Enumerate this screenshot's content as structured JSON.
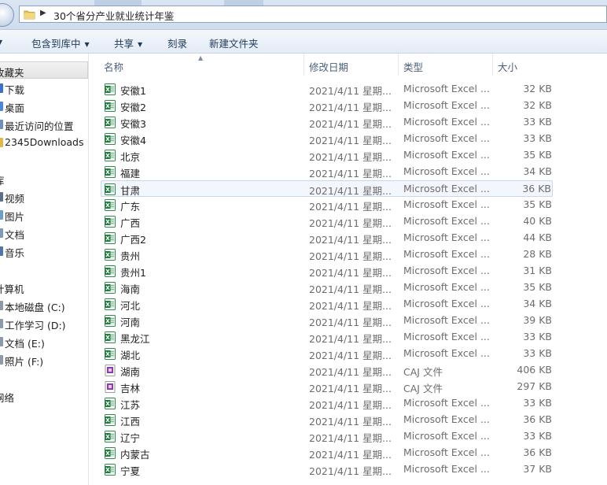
{
  "address": {
    "path": "30个省分产业就业统计年鉴"
  },
  "toolbar": {
    "items": [
      {
        "label": "包含到库中",
        "dropdown": true
      },
      {
        "label": "共享",
        "dropdown": true
      },
      {
        "label": "刻录",
        "dropdown": false
      },
      {
        "label": "新建文件夹",
        "dropdown": false
      }
    ]
  },
  "nav": {
    "items": [
      {
        "label": "收藏夹",
        "kind": "group",
        "selected": true
      },
      {
        "label": "下载",
        "kind": "item"
      },
      {
        "label": "桌面",
        "kind": "item"
      },
      {
        "label": "最近访问的位置",
        "kind": "item"
      },
      {
        "label": "2345Downloads",
        "kind": "item"
      },
      {
        "label": "库",
        "kind": "group"
      },
      {
        "label": "视频",
        "kind": "item"
      },
      {
        "label": "图片",
        "kind": "item"
      },
      {
        "label": "文档",
        "kind": "item"
      },
      {
        "label": "音乐",
        "kind": "item"
      },
      {
        "label": "计算机",
        "kind": "group"
      },
      {
        "label": "本地磁盘 (C:)",
        "kind": "item"
      },
      {
        "label": "工作学习 (D:)",
        "kind": "item"
      },
      {
        "label": "文档 (E:)",
        "kind": "item"
      },
      {
        "label": "照片 (F:)",
        "kind": "item"
      },
      {
        "label": "网络",
        "kind": "group"
      }
    ]
  },
  "columns": {
    "name": "名称",
    "date": "修改日期",
    "type": "类型",
    "size": "大小"
  },
  "files": [
    {
      "name": "安徽1",
      "date": "2021/4/11 星期...",
      "type": "Microsoft Excel ...",
      "size": "32 KB",
      "icon": "excel-file-icon"
    },
    {
      "name": "安徽2",
      "date": "2021/4/11 星期...",
      "type": "Microsoft Excel ...",
      "size": "32 KB",
      "icon": "excel-file-icon"
    },
    {
      "name": "安徽3",
      "date": "2021/4/11 星期...",
      "type": "Microsoft Excel ...",
      "size": "33 KB",
      "icon": "excel-file-icon"
    },
    {
      "name": "安徽4",
      "date": "2021/4/11 星期...",
      "type": "Microsoft Excel ...",
      "size": "33 KB",
      "icon": "excel-file-icon"
    },
    {
      "name": "北京",
      "date": "2021/4/11 星期...",
      "type": "Microsoft Excel ...",
      "size": "35 KB",
      "icon": "excel-file-icon"
    },
    {
      "name": "福建",
      "date": "2021/4/11 星期...",
      "type": "Microsoft Excel ...",
      "size": "34 KB",
      "icon": "excel-file-icon"
    },
    {
      "name": "甘肃",
      "date": "2021/4/11 星期...",
      "type": "Microsoft Excel ...",
      "size": "36 KB",
      "icon": "excel-file-icon",
      "hover": true
    },
    {
      "name": "广东",
      "date": "2021/4/11 星期...",
      "type": "Microsoft Excel ...",
      "size": "35 KB",
      "icon": "excel-file-icon"
    },
    {
      "name": "广西",
      "date": "2021/4/11 星期...",
      "type": "Microsoft Excel ...",
      "size": "40 KB",
      "icon": "excel-file-icon"
    },
    {
      "name": "广西2",
      "date": "2021/4/11 星期...",
      "type": "Microsoft Excel ...",
      "size": "44 KB",
      "icon": "excel-file-icon"
    },
    {
      "name": "贵州",
      "date": "2021/4/11 星期...",
      "type": "Microsoft Excel ...",
      "size": "28 KB",
      "icon": "excel-file-icon"
    },
    {
      "name": "贵州1",
      "date": "2021/4/11 星期...",
      "type": "Microsoft Excel ...",
      "size": "31 KB",
      "icon": "excel-file-icon"
    },
    {
      "name": "海南",
      "date": "2021/4/11 星期...",
      "type": "Microsoft Excel ...",
      "size": "35 KB",
      "icon": "excel-file-icon"
    },
    {
      "name": "河北",
      "date": "2021/4/11 星期...",
      "type": "Microsoft Excel ...",
      "size": "34 KB",
      "icon": "excel-file-icon"
    },
    {
      "name": "河南",
      "date": "2021/4/11 星期...",
      "type": "Microsoft Excel ...",
      "size": "39 KB",
      "icon": "excel-file-icon"
    },
    {
      "name": "黑龙江",
      "date": "2021/4/11 星期...",
      "type": "Microsoft Excel ...",
      "size": "33 KB",
      "icon": "excel-file-icon"
    },
    {
      "name": "湖北",
      "date": "2021/4/11 星期...",
      "type": "Microsoft Excel ...",
      "size": "33 KB",
      "icon": "excel-file-icon"
    },
    {
      "name": "湖南",
      "date": "2021/4/11 星期...",
      "type": "CAJ 文件",
      "size": "406 KB",
      "icon": "caj-file-icon"
    },
    {
      "name": "吉林",
      "date": "2021/4/11 星期...",
      "type": "CAJ 文件",
      "size": "297 KB",
      "icon": "caj-file-icon"
    },
    {
      "name": "江苏",
      "date": "2021/4/11 星期...",
      "type": "Microsoft Excel ...",
      "size": "33 KB",
      "icon": "excel-file-icon"
    },
    {
      "name": "江西",
      "date": "2021/4/11 星期...",
      "type": "Microsoft Excel ...",
      "size": "36 KB",
      "icon": "excel-file-icon"
    },
    {
      "name": "辽宁",
      "date": "2021/4/11 星期...",
      "type": "Microsoft Excel ...",
      "size": "33 KB",
      "icon": "excel-file-icon"
    },
    {
      "name": "内蒙古",
      "date": "2021/4/11 星期...",
      "type": "Microsoft Excel ...",
      "size": "36 KB",
      "icon": "excel-file-icon"
    },
    {
      "name": "宁夏",
      "date": "2021/4/11 星期...",
      "type": "Microsoft Excel ...",
      "size": "37 KB",
      "icon": "excel-file-icon"
    }
  ],
  "colors": {
    "excel_green": "#1f7a3c",
    "caj_purple": "#8a3fa8",
    "toolbar_text": "#1e395b",
    "header_text": "#4c607a",
    "meta_text": "#6d6d6d"
  }
}
